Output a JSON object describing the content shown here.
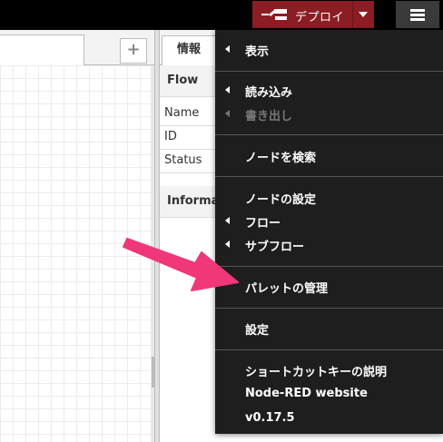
{
  "header": {
    "deploy_label": "デプロイ",
    "deploy_color": "#8c1d25"
  },
  "workspace": {
    "add_tab_label": "+"
  },
  "sidebar": {
    "tab_info_label": "情報",
    "flow_section_title": "Flow",
    "rows": [
      {
        "label": "Name"
      },
      {
        "label": "ID"
      },
      {
        "label": "Status"
      }
    ],
    "info_section_title": "Informat"
  },
  "menu": {
    "items": [
      {
        "label": "表示"
      },
      {
        "label": "読み込み"
      },
      {
        "label": "書き出し"
      },
      {
        "label": "ノードを検索"
      },
      {
        "label": "ノードの設定"
      },
      {
        "label": "フロー"
      },
      {
        "label": "サブフロー"
      },
      {
        "label": "パレットの管理"
      },
      {
        "label": "設定"
      },
      {
        "label": "ショートカットキーの説明"
      },
      {
        "label": "Node-RED website"
      },
      {
        "label": "v0.17.5"
      }
    ]
  },
  "annotation": {
    "arrow_color": "#f0377a",
    "icon": "pointer-arrow"
  }
}
